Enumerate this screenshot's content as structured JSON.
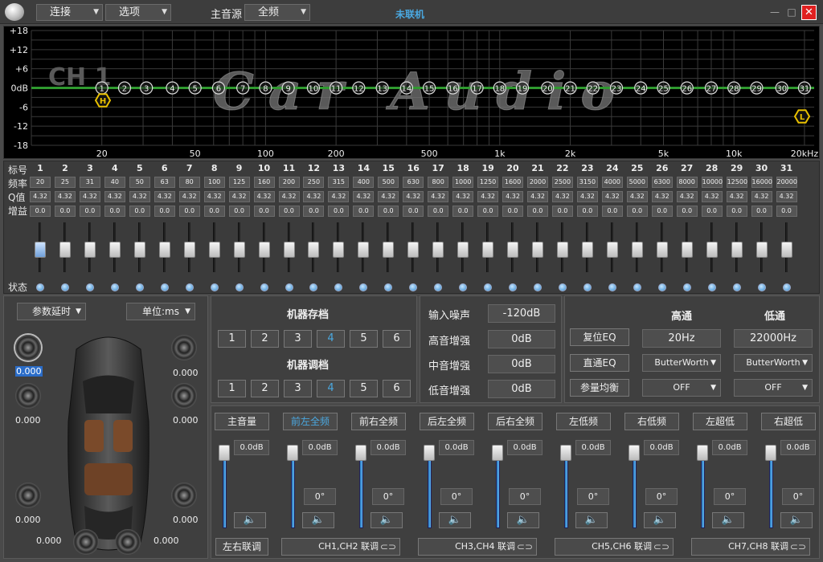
{
  "titlebar": {
    "connect": "连接",
    "options": "选项",
    "master_label": "主音源",
    "master_value": "全频",
    "status": "未联机",
    "close": "✕",
    "minimize": "—",
    "maximize": "□"
  },
  "graph": {
    "channel": "CH 1",
    "watermark": "Car Audio",
    "y_ticks": [
      "+18",
      "+12",
      "+6",
      "0dB",
      "-6",
      "-12",
      "-18"
    ],
    "x_ticks": [
      "20",
      "50",
      "100",
      "200",
      "500",
      "1k",
      "2k",
      "5k",
      "10k",
      "20kHz"
    ],
    "hp_marker": "H",
    "lp_marker": "L"
  },
  "bands": {
    "row_labels": {
      "num": "标号",
      "freq": "频率",
      "q": "Q值",
      "gain": "增益",
      "status": "状态"
    },
    "numbers": [
      "1",
      "2",
      "3",
      "4",
      "5",
      "6",
      "7",
      "8",
      "9",
      "10",
      "11",
      "12",
      "13",
      "14",
      "15",
      "16",
      "17",
      "18",
      "19",
      "20",
      "21",
      "22",
      "23",
      "24",
      "25",
      "26",
      "27",
      "28",
      "29",
      "30",
      "31"
    ],
    "freqs": [
      "20",
      "25",
      "31",
      "40",
      "50",
      "63",
      "80",
      "100",
      "125",
      "160",
      "200",
      "250",
      "315",
      "400",
      "500",
      "630",
      "800",
      "1000",
      "1250",
      "1600",
      "2000",
      "2500",
      "3150",
      "4000",
      "5000",
      "6300",
      "8000",
      "10000",
      "12500",
      "16000",
      "20000"
    ],
    "q": "4.32",
    "gain": "0.0",
    "selected_index": 0
  },
  "delay": {
    "mode": "参数延时",
    "unit": "单位:ms",
    "values": [
      "0.000",
      "0.000",
      "0.000",
      "0.000",
      "0.000",
      "0.000",
      "0.000",
      "0.000",
      "0.000",
      "0.000"
    ]
  },
  "memory": {
    "save_title": "机器存档",
    "load_title": "机器调档",
    "slots": [
      "1",
      "2",
      "3",
      "4",
      "5",
      "6"
    ],
    "active_slot": "4"
  },
  "params": {
    "noise_label": "输入噪声",
    "noise_value": "-120dB",
    "treble_label": "高音增强",
    "treble_value": "0dB",
    "mid_label": "中音增强",
    "mid_value": "0dB",
    "bass_label": "低音增强",
    "bass_value": "0dB"
  },
  "filters": {
    "hp_title": "高通",
    "lp_title": "低通",
    "reset_eq": "复位EQ",
    "bypass_eq": "直通EQ",
    "param_eq": "参量均衡",
    "hp_freq": "20Hz",
    "lp_freq": "22000Hz",
    "hp_type": "ButterWorth",
    "lp_type": "ButterWorth",
    "hp_slope": "OFF",
    "lp_slope": "OFF"
  },
  "channels": {
    "tabs": [
      "主音量",
      "前左全频",
      "前右全频",
      "后左全频",
      "后右全频",
      "左低频",
      "右低频",
      "左超低",
      "右超低"
    ],
    "active_tab": 1,
    "db": "0.0dB",
    "deg": "0°",
    "lr_link": "左右联调",
    "links": [
      "CH1,CH2 联调",
      "CH3,CH4 联调",
      "CH5,CH6 联调",
      "CH7,CH8 联调"
    ]
  },
  "colors": {
    "accent": "#4aa8e0",
    "eq_line": "#2f9a2f",
    "marker": "#e8c000"
  }
}
